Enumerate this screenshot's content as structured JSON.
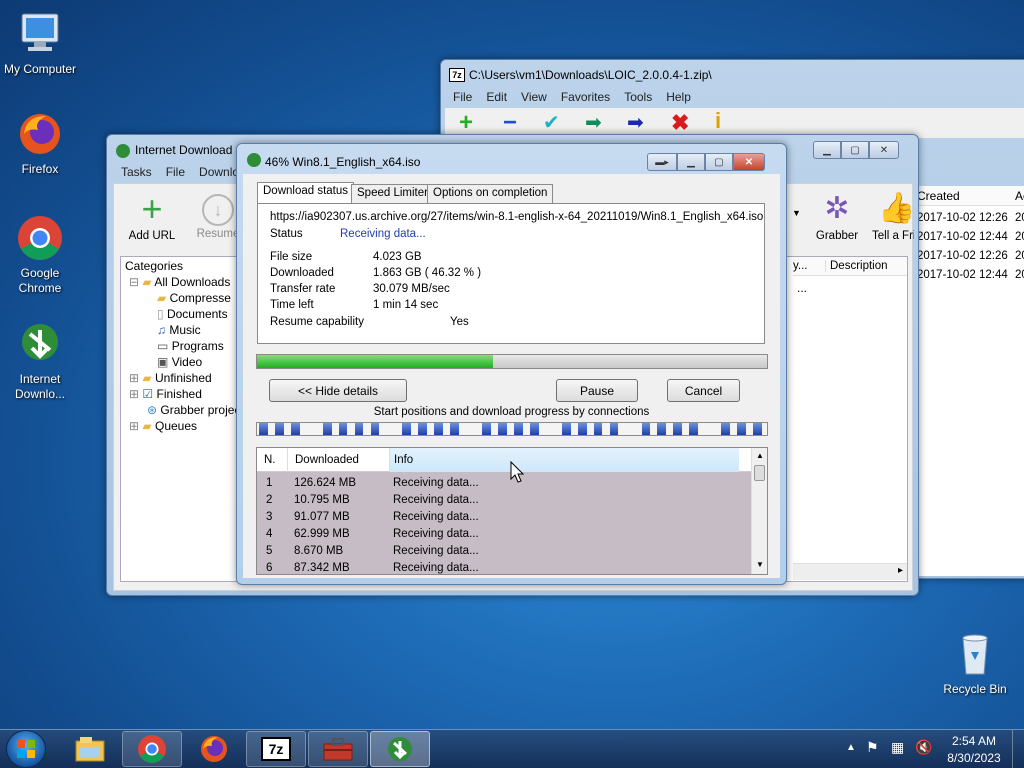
{
  "desktop": {
    "icons": [
      {
        "label": "My Computer"
      },
      {
        "label": "Firefox"
      },
      {
        "label": "Google Chrome"
      },
      {
        "label": "Internet Downlo..."
      },
      {
        "label": "Recycle Bin"
      }
    ]
  },
  "zip_window": {
    "title": "C:\\Users\\vm1\\Downloads\\LOIC_2.0.0.4-1.zip\\",
    "menu": [
      "File",
      "Edit",
      "View",
      "Favorites",
      "Tools",
      "Help"
    ],
    "columns": [
      "Created",
      "Ac"
    ],
    "created": [
      "2017-10-02 12:26",
      "2017-10-02 12:44",
      "2017-10-02 12:26",
      "2017-10-02 12:44"
    ],
    "accessed": [
      "20",
      "20",
      "20",
      "20"
    ]
  },
  "idm_main": {
    "title": "Internet Download",
    "menu": [
      "Tasks",
      "File",
      "Downlo"
    ],
    "toolbar": {
      "add_url": "Add URL",
      "resume": "Resume",
      "grabber": "Grabber",
      "tell_friend": "Tell a Fri"
    },
    "categories_label": "Categories",
    "tree": [
      "All Downloads",
      "Compresse",
      "Documents",
      "Music",
      "Programs",
      "Video",
      "Unfinished",
      "Finished",
      "Grabber projec",
      "Queues"
    ],
    "list_columns": [
      "y...",
      "Description"
    ],
    "list_cell": "..."
  },
  "dl_dialog": {
    "title": "46% Win8.1_English_x64.iso",
    "tabs": [
      "Download status",
      "Speed Limiter",
      "Options on completion"
    ],
    "url": "https://ia902307.us.archive.org/27/items/win-8.1-english-x-64_20211019/Win8.1_English_x64.iso",
    "status_label": "Status",
    "status_value": "Receiving data...",
    "file_size_label": "File size",
    "file_size_value": "4.023  GB",
    "downloaded_label": "Downloaded",
    "downloaded_value": "1.863  GB  ( 46.32 % )",
    "rate_label": "Transfer rate",
    "rate_value": "30.079  MB/sec",
    "time_label": "Time left",
    "time_value": "1 min 14 sec",
    "resume_label": "Resume capability",
    "resume_value": "Yes",
    "progress_fraction": 0.4632,
    "hide_details": "<< Hide details",
    "pause": "Pause",
    "cancel": "Cancel",
    "connections_caption": "Start positions and download progress by connections",
    "table_columns": [
      "N.",
      "Downloaded",
      "Info"
    ],
    "rows": [
      {
        "n": "1",
        "downloaded": "126.624  MB",
        "info": "Receiving data..."
      },
      {
        "n": "2",
        "downloaded": "10.795  MB",
        "info": "Receiving data..."
      },
      {
        "n": "3",
        "downloaded": "91.077  MB",
        "info": "Receiving data..."
      },
      {
        "n": "4",
        "downloaded": "62.999  MB",
        "info": "Receiving data..."
      },
      {
        "n": "5",
        "downloaded": "8.670  MB",
        "info": "Receiving data..."
      },
      {
        "n": "6",
        "downloaded": "87.342  MB",
        "info": "Receiving data..."
      }
    ]
  },
  "taskbar": {
    "time": "2:54 AM",
    "date": "8/30/2023",
    "apps": [
      "explorer-icon",
      "chrome-icon",
      "firefox-icon",
      "7zip-icon",
      "toolbox-icon",
      "idm-icon"
    ]
  },
  "colors": {
    "accent": "#1f4fa8",
    "progress": "#28b828",
    "taskbar": "#1a3b66"
  }
}
